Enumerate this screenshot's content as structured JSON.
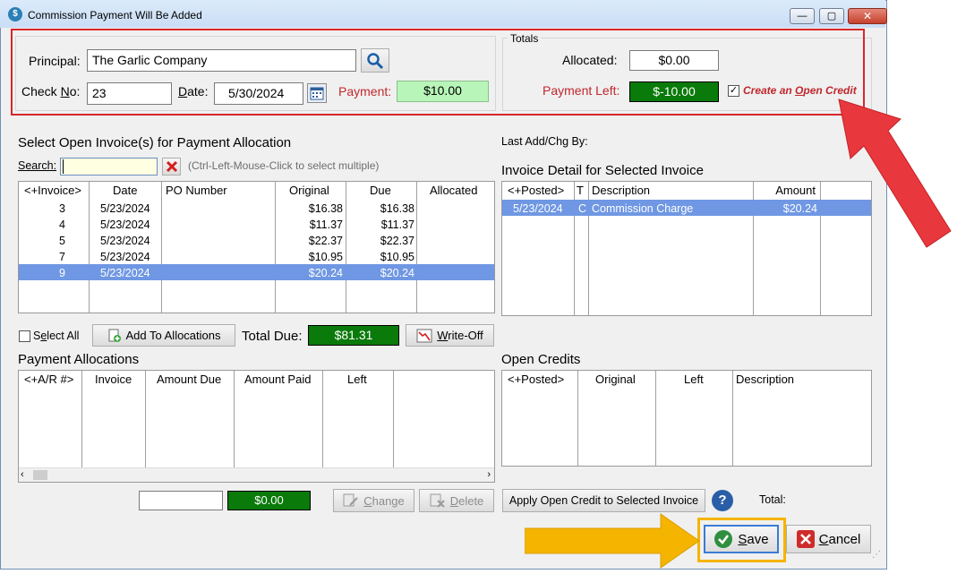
{
  "window": {
    "title": "Commission Payment Will Be Added",
    "minimize": "—",
    "maximize": "▢",
    "close": "✕"
  },
  "header": {
    "principal_label": "Principal:",
    "principal_value": "The Garlic Company",
    "checkno_label_pre": "Check ",
    "checkno_label_u": "N",
    "checkno_label_post": "o:",
    "checkno_value": "23",
    "date_label_pre": "D",
    "date_label_post": "ate:",
    "date_value": "5/30/2024",
    "payment_label": "Payment:",
    "payment_value": "$10.00"
  },
  "totals": {
    "title": "Totals",
    "allocated_label": "Allocated:",
    "allocated_value": "$0.00",
    "payment_left_label": "Payment Left:",
    "payment_left_value": "$-10.00",
    "open_credit_pre": "Create an ",
    "open_credit_u": "O",
    "open_credit_post": "pen Credit"
  },
  "invoices": {
    "title": "Select Open Invoice(s) for Payment Allocation",
    "search_label": "Search:",
    "search_value": "",
    "hint": "(Ctrl-Left-Mouse-Click to select multiple)",
    "columns": [
      "<+Invoice>",
      "Date",
      "PO Number",
      "Original",
      "Due",
      "Allocated"
    ],
    "rows": [
      {
        "invoice": "3",
        "date": "5/23/2024",
        "po": "",
        "original": "$16.38",
        "due": "$16.38",
        "allocated": ""
      },
      {
        "invoice": "4",
        "date": "5/23/2024",
        "po": "",
        "original": "$11.37",
        "due": "$11.37",
        "allocated": ""
      },
      {
        "invoice": "5",
        "date": "5/23/2024",
        "po": "",
        "original": "$22.37",
        "due": "$22.37",
        "allocated": ""
      },
      {
        "invoice": "7",
        "date": "5/23/2024",
        "po": "",
        "original": "$10.95",
        "due": "$10.95",
        "allocated": ""
      },
      {
        "invoice": "9",
        "date": "5/23/2024",
        "po": "",
        "original": "$20.24",
        "due": "$20.24",
        "allocated": ""
      }
    ],
    "select_all_label_pre": "S",
    "select_all_label_u": "e",
    "select_all_label_post": "lect All",
    "add_button": "Add To Allocations",
    "total_due_label": "Total Due:",
    "total_due_value": "$81.31",
    "writeoff_u": "W",
    "writeoff_post": "rite-Off"
  },
  "detail": {
    "last_add_label": "Last Add/Chg By:",
    "title": "Invoice Detail for Selected Invoice",
    "columns": [
      "<+Posted>",
      "T",
      "Description",
      "Amount"
    ],
    "rows": [
      {
        "posted": "5/23/2024",
        "t": "C",
        "description": "Commission Charge",
        "amount": "$20.24"
      }
    ]
  },
  "allocations": {
    "title": "Payment Allocations",
    "columns": [
      "<+A/R #>",
      "Invoice",
      "Amount Due",
      "Amount Paid",
      "Left"
    ],
    "amount_value": "",
    "green_value": "$0.00",
    "change_u": "C",
    "change_post": "hange",
    "delete_u": "D",
    "delete_post": "elete"
  },
  "credits": {
    "title": "Open Credits",
    "columns": [
      "<+Posted>",
      "Original",
      "Left",
      "Description"
    ],
    "apply_button": "Apply Open Credit to Selected Invoice",
    "help": "?",
    "total_label": "Total:"
  },
  "footer": {
    "save_u": "S",
    "save_post": "ave",
    "cancel_u": "C",
    "cancel_post": "ancel"
  },
  "colors": {
    "highlight_red": "#d9262c",
    "arrow_orange": "#f5b400",
    "selection": "#6f97e3",
    "green": "#0a7a0a"
  }
}
